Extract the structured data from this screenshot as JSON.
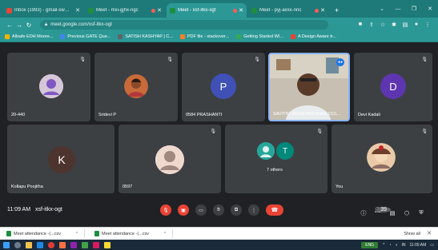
{
  "browser": {
    "tabs": [
      {
        "title": "Inbox (1993) - gmail-sw@nce2068...",
        "icon_color": "#e8453c",
        "active": false
      },
      {
        "title": "Meet - mxi-gjhx-ngc",
        "icon_color": "#1e8e3e",
        "active": false
      },
      {
        "title": "Meet - xsf-itkx-xgt",
        "icon_color": "#1e8e3e",
        "active": true
      },
      {
        "title": "Meet - pyj-axxx-nnc",
        "icon_color": "#1e8e3e",
        "active": false
      }
    ],
    "new_tab_label": "+",
    "url": "meet.google.com/xsf-itkx-ogt",
    "bookmarks": [
      {
        "label": "Allsafe EDH Moore...",
        "icon_color": "#f4b400"
      },
      {
        "label": "Previous GATE Que...",
        "icon_color": "#4285f4"
      },
      {
        "label": "SATISH KASHYAP | C...",
        "icon_color": "#5f6368"
      },
      {
        "label": "PDF file - stackover...",
        "icon_color": "#f48024"
      },
      {
        "label": "Getting Started WI...",
        "icon_color": "#34a853"
      },
      {
        "label": "A Design Aware tr...",
        "icon_color": "#ea4335"
      }
    ]
  },
  "meet": {
    "participants": [
      {
        "name": "20-440",
        "kind": "avatar-person"
      },
      {
        "name": "Sridevi P",
        "kind": "photo"
      },
      {
        "name": "0584 PRASHANTI",
        "kind": "letter",
        "letter": "P",
        "color": "#3f51b5"
      },
      {
        "name": "SAVITRI VIDYA PARISHAD COL...",
        "kind": "video"
      },
      {
        "name": "Devi Kadali",
        "kind": "letter",
        "letter": "D",
        "color": "#5e35b1"
      },
      {
        "name": "Kollapu Poojitha",
        "kind": "letter",
        "letter": "K",
        "color": "#4e342e"
      },
      {
        "name": "0597",
        "kind": "avatar-person"
      },
      {
        "name": "7 others",
        "kind": "group"
      },
      {
        "name": "You",
        "kind": "photo-you"
      }
    ],
    "time": "11:09 AM",
    "meeting_code": "xsf-itkx-ogt",
    "participant_count": "39"
  },
  "downloads": {
    "items": [
      {
        "name": "Meet attendance -(...csv"
      },
      {
        "name": "Meet attendance -(...csv"
      }
    ],
    "show_all": "Show all"
  },
  "taskbar": {
    "tray_tag": "ENG",
    "tray_info": "IN",
    "clock": "11:09 AM"
  },
  "colors": {
    "meet_bg": "#202124",
    "tile_bg": "#3c4043",
    "chrome_teal": "#2c9896",
    "end_call": "#ea4335"
  }
}
